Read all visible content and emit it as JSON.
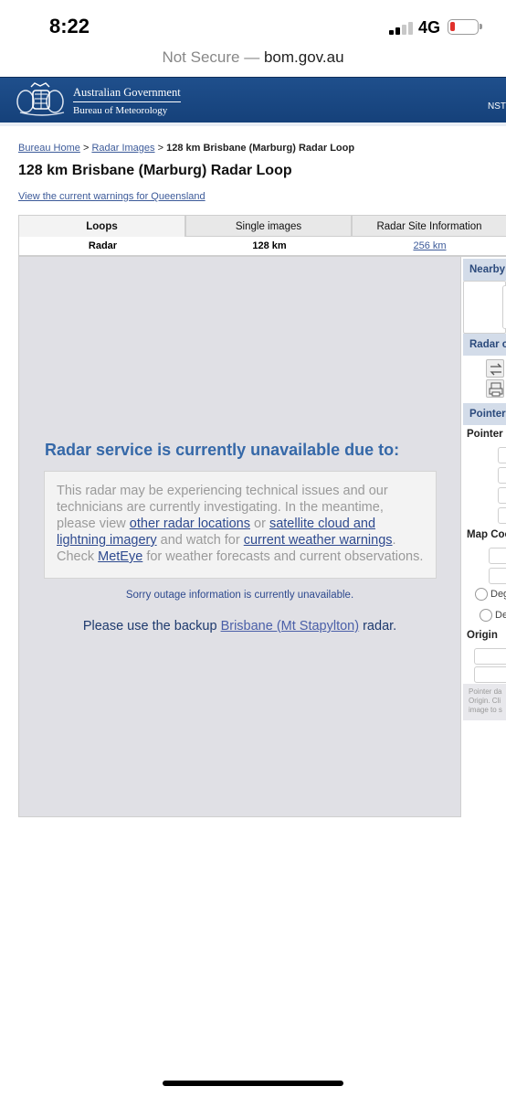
{
  "status_bar": {
    "time": "8:22",
    "network": "4G"
  },
  "browser": {
    "security": "Not Secure",
    "separator": "—",
    "domain": "bom.gov.au"
  },
  "header": {
    "gov_name": "Australian Government",
    "agency": "Bureau of Meteorology",
    "nav_fragment": "NST",
    "brand_color": "#1f4f8c"
  },
  "breadcrumb": {
    "home": "Bureau Home",
    "sep": ">",
    "radar_images": "Radar Images",
    "current": "128 km Brisbane (Marburg) Radar Loop"
  },
  "page_title": "128 km Brisbane (Marburg) Radar Loop",
  "warnings_link": "View the current warnings for Queensland",
  "tabs": [
    {
      "label": "Loops",
      "active": true
    },
    {
      "label": "Single images",
      "active": false
    },
    {
      "label": "Radar Site Information",
      "active": false
    }
  ],
  "subtabs": {
    "type": "Radar",
    "current_range": "128 km",
    "other_range": "256 km"
  },
  "radar": {
    "heading": "Radar service is currently unavailable due to:",
    "notice": {
      "t1": "This radar may be experiencing technical issues and our technicians are currently investigating. In the meantime, please view ",
      "link1": "other radar locations",
      "t2": " or ",
      "link2": "satellite cloud and lightning imagery",
      "t3": " and watch for ",
      "link3": "current weather warnings",
      "t4": ". Check ",
      "link4": "MetEye",
      "t5": " for weather forecasts and current observations."
    },
    "outage": "Sorry outage information is currently unavailable.",
    "backup": {
      "pre": "Please use the backup ",
      "link": "Brisbane (Mt Stapylton)",
      "post": " radar."
    }
  },
  "sidebar": {
    "nearby": "Nearby",
    "radar_controls": "Radar c",
    "pointer_head": "Pointer",
    "pointer_label": "Pointer",
    "map_coords": "Map Coo",
    "radio1": "Deg",
    "radio2": "De",
    "origin": "Origin",
    "foot1": "Pointer da",
    "foot2": "Origin. Cli",
    "foot3": "image to s"
  }
}
